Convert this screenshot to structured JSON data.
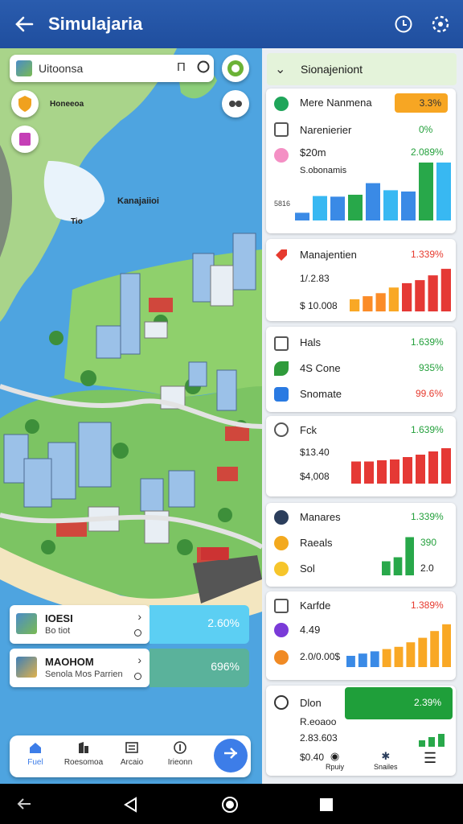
{
  "appbar": {
    "title": "Simulajaria",
    "back_icon": "arrow-left-icon",
    "icons": [
      "timer-icon",
      "settings-icon"
    ]
  },
  "map": {
    "search": {
      "value": "Uitoonsa",
      "side1": "Π"
    },
    "labels": [
      "Honeeoa",
      "Kanajaiioi",
      "Tio"
    ],
    "tiles": [
      {
        "title": "IOESI",
        "subtitle": "Bo tiot",
        "value": "2.60%",
        "color": "#5ccff3"
      },
      {
        "title": "MAOHOM",
        "subtitle": "Senola Mos Parrien",
        "value": "696%",
        "color": "#5ab29b"
      }
    ],
    "nav": [
      {
        "label": "Fuel",
        "icon": "home-icon",
        "color": "#3d7de8"
      },
      {
        "label": "Roesomoa",
        "icon": "building-icon",
        "color": "#333"
      },
      {
        "label": "Arcaio",
        "icon": "list-icon",
        "color": "#333"
      },
      {
        "label": "Irieonn",
        "icon": "info-icon",
        "color": "#333"
      }
    ],
    "nav_fab_icon": "shield-plus-icon"
  },
  "panel": {
    "header": "Sionajeniont",
    "cards": [
      {
        "id": "c1",
        "tag": {
          "label": "Mere Nanmena",
          "value": "3.3%",
          "color": "#f7a623"
        },
        "rows": [
          {
            "label": "Narenierier",
            "value": "0%"
          },
          {
            "label": "$20m",
            "value": "2.089%"
          },
          {
            "label": "S.obonamis",
            "value": ""
          }
        ],
        "axis": "5816",
        "bars": [
          {
            "v": 0.12,
            "c": "#3a8ae6"
          },
          {
            "v": 0.38,
            "c": "#38b8f2"
          },
          {
            "v": 0.37,
            "c": "#3a8ae6"
          },
          {
            "v": 0.4,
            "c": "#28a84a"
          },
          {
            "v": 0.58,
            "c": "#3a8ae6"
          },
          {
            "v": 0.47,
            "c": "#38b8f2"
          },
          {
            "v": 0.45,
            "c": "#3a8ae6"
          },
          {
            "v": 0.9,
            "c": "#28a84a"
          },
          {
            "v": 0.9,
            "c": "#38b8f2"
          }
        ]
      },
      {
        "id": "c2",
        "title": "Manajentien",
        "value": "1.339%",
        "rows": [
          {
            "label": "1/.2.83"
          },
          {
            "label": "$ 10.008"
          }
        ],
        "bars": [
          {
            "v": 0.28,
            "c": "#f9a825"
          },
          {
            "v": 0.35,
            "c": "#fb8c28"
          },
          {
            "v": 0.42,
            "c": "#fb8c28"
          },
          {
            "v": 0.55,
            "c": "#f9a825"
          },
          {
            "v": 0.65,
            "c": "#e53935"
          },
          {
            "v": 0.72,
            "c": "#e53935"
          },
          {
            "v": 0.83,
            "c": "#e53935"
          },
          {
            "v": 0.98,
            "c": "#e53935"
          }
        ]
      },
      {
        "id": "c3",
        "rows": [
          {
            "label": "Hals",
            "value": "1.639%",
            "color": "#24a03c"
          },
          {
            "label": "4S Cone",
            "value": "935%",
            "color": "#24a03c"
          },
          {
            "label": "Snomate",
            "value": "99.6%",
            "color": "#e63a2e"
          }
        ]
      },
      {
        "id": "c4",
        "title": "Fck",
        "value": "1.639%",
        "rows": [
          {
            "label": "$13.40"
          },
          {
            "label": "$4,008"
          }
        ],
        "bars": [
          {
            "v": 0.55,
            "c": "#e53935"
          },
          {
            "v": 0.55,
            "c": "#e53935"
          },
          {
            "v": 0.58,
            "c": "#e53935"
          },
          {
            "v": 0.6,
            "c": "#e53935"
          },
          {
            "v": 0.66,
            "c": "#e53935"
          },
          {
            "v": 0.72,
            "c": "#e53935"
          },
          {
            "v": 0.8,
            "c": "#e53935"
          },
          {
            "v": 0.88,
            "c": "#e53935"
          }
        ]
      },
      {
        "id": "c5",
        "title": "Manares",
        "value": "1.339%",
        "rows": [
          {
            "label": "Raeals",
            "value": "390"
          },
          {
            "label": "Sol",
            "value": "2.0"
          }
        ],
        "bars": [
          {
            "v": 0.35,
            "c": "#28a84a"
          },
          {
            "v": 0.45,
            "c": "#28a84a"
          },
          {
            "v": 0.95,
            "c": "#28a84a"
          }
        ]
      },
      {
        "id": "c6",
        "title": "Karfde",
        "value": "1.389%",
        "rows": [
          {
            "label": "4.49"
          },
          {
            "label": "2.0/0.00$"
          }
        ],
        "bars": [
          {
            "v": 0.25,
            "c": "#3a8ae6"
          },
          {
            "v": 0.3,
            "c": "#3a8ae6"
          },
          {
            "v": 0.35,
            "c": "#3a8ae6"
          },
          {
            "v": 0.4,
            "c": "#f9a825"
          },
          {
            "v": 0.45,
            "c": "#f9a825"
          },
          {
            "v": 0.55,
            "c": "#f9a825"
          },
          {
            "v": 0.65,
            "c": "#f9a825"
          },
          {
            "v": 0.8,
            "c": "#f9a825"
          },
          {
            "v": 0.95,
            "c": "#f9a825"
          }
        ]
      },
      {
        "id": "c7",
        "title": "Dlon",
        "badge": "2.39%",
        "rows": [
          {
            "label": "R.eoaoo"
          },
          {
            "label": "2.83.603"
          },
          {
            "label": "$0.40"
          }
        ],
        "footer": [
          {
            "label": "Rpuiy",
            "icon": "spin-icon"
          },
          {
            "label": "Snailes",
            "icon": "star-icon"
          }
        ]
      }
    ]
  }
}
